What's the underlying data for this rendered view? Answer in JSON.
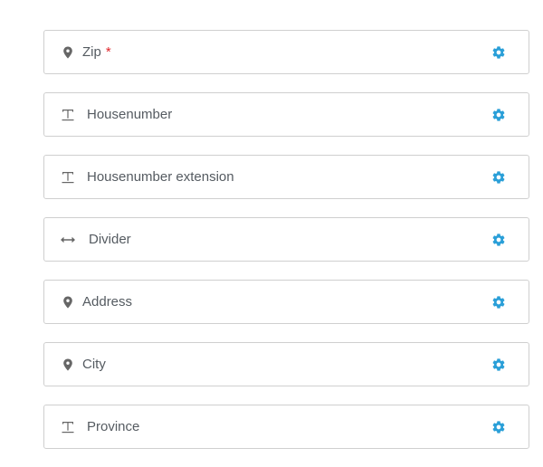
{
  "colors": {
    "gear": "#2a9fd8",
    "required": "#e0262b",
    "icon": "#666666",
    "border": "#cfcfcf",
    "label": "#555b61"
  },
  "fields": [
    {
      "label": "Zip",
      "icon": "map-pin-icon",
      "required_mark": "*"
    },
    {
      "label": "Housenumber",
      "icon": "text-field-icon",
      "required_mark": ""
    },
    {
      "label": "Housenumber extension",
      "icon": "text-field-icon",
      "required_mark": ""
    },
    {
      "label": "Divider",
      "icon": "divider-arrows-icon",
      "required_mark": ""
    },
    {
      "label": "Address",
      "icon": "map-pin-icon",
      "required_mark": ""
    },
    {
      "label": "City",
      "icon": "map-pin-icon",
      "required_mark": ""
    },
    {
      "label": "Province",
      "icon": "text-field-icon",
      "required_mark": ""
    }
  ]
}
